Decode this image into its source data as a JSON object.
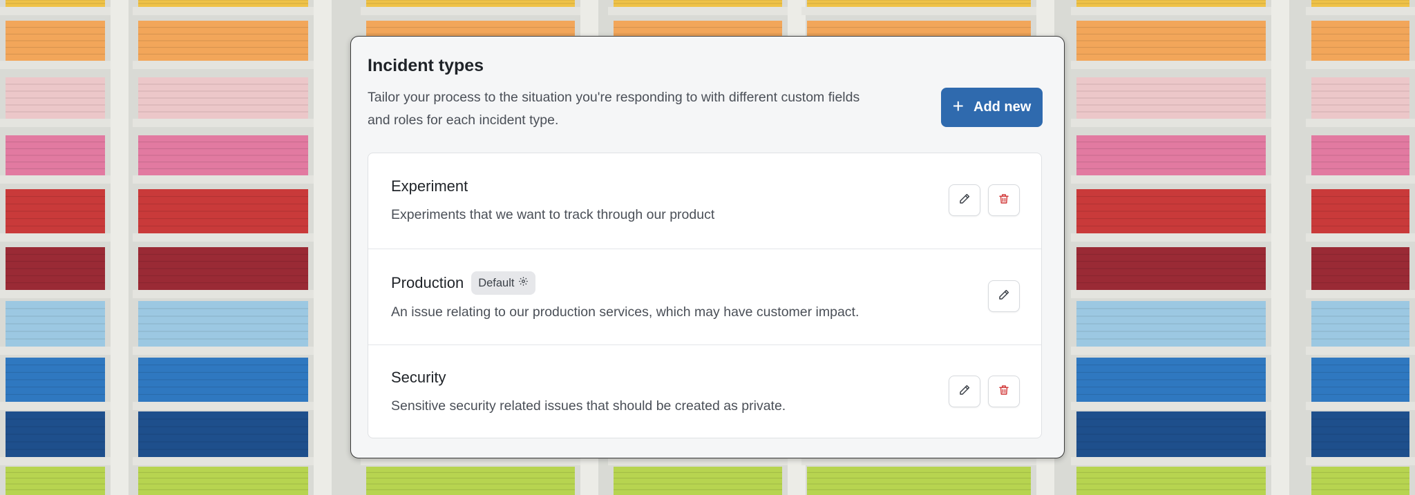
{
  "panel": {
    "title": "Incident types",
    "description": "Tailor your process to the situation you're responding to with different custom fields and roles for each incident type.",
    "add_button": {
      "label": "Add new",
      "icon": "plus-icon",
      "color": "#2f6aae"
    }
  },
  "incident_types": [
    {
      "name": "Experiment",
      "description": "Experiments that we want to track through our product",
      "badge": null,
      "actions": [
        "edit-icon",
        "trash-icon"
      ]
    },
    {
      "name": "Production",
      "description": "An issue relating to our production services, which may have customer impact.",
      "badge": "Default",
      "actions": [
        "edit-icon"
      ]
    },
    {
      "name": "Security",
      "description": "Sensitive security related issues that should be created as private.",
      "badge": null,
      "actions": [
        "edit-icon",
        "trash-icon"
      ]
    }
  ],
  "colors": {
    "delete_icon": "#d23b3b",
    "edit_icon": "#3a3f46"
  }
}
